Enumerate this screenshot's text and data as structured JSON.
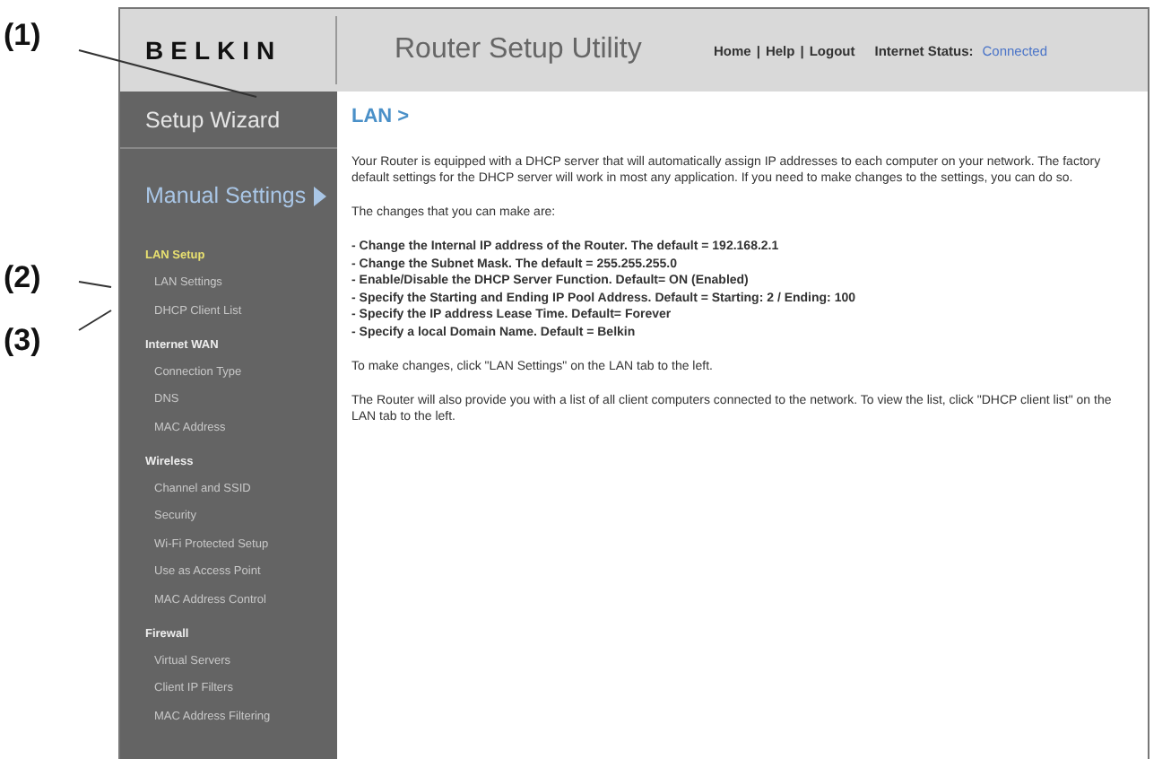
{
  "callouts": [
    {
      "label": "(1)"
    },
    {
      "label": "(2)"
    },
    {
      "label": "(3)"
    }
  ],
  "header": {
    "logo": "BELKIN",
    "title": "Router Setup Utility",
    "links": [
      "Home",
      "Help",
      "Logout"
    ],
    "link_separator": "|",
    "status_label": "Internet Status:",
    "status_value": "Connected"
  },
  "sidebar": {
    "wizard": "Setup Wizard",
    "manual": "Manual Settings",
    "sections": [
      {
        "title": "LAN Setup",
        "selected": true,
        "items": [
          "LAN Settings",
          "DHCP Client List"
        ]
      },
      {
        "title": "Internet WAN",
        "selected": false,
        "items": [
          "Connection Type",
          "DNS",
          "MAC Address"
        ]
      },
      {
        "title": "Wireless",
        "selected": false,
        "items": [
          "Channel and SSID",
          "Security",
          "Wi-Fi Protected Setup",
          "Use as Access Point",
          "MAC Address Control"
        ]
      },
      {
        "title": "Firewall",
        "selected": false,
        "items": [
          "Virtual Servers",
          "Client IP Filters",
          "MAC Address Filtering"
        ]
      }
    ]
  },
  "content": {
    "breadcrumb": "LAN >",
    "intro": "Your Router is equipped with a DHCP server that will automatically assign IP addresses to each computer on your network. The factory default settings for the DHCP server will work in most any application. If you need to make changes to the settings, you can do so.",
    "changes_heading": "The changes that you can make are:",
    "changes": [
      "- Change the Internal IP address of the Router. The default = 192.168.2.1",
      "- Change the Subnet Mask. The default = 255.255.255.0",
      "- Enable/Disable the DHCP Server Function. Default= ON (Enabled)",
      "- Specify the Starting and Ending IP Pool Address. Default = Starting: 2 / Ending: 100",
      "- Specify the IP address Lease Time. Default= Forever",
      "- Specify a local Domain Name. Default = Belkin"
    ],
    "note1": "To make changes, click \"LAN Settings\" on the LAN tab to the left.",
    "note2": "The Router will also provide you with a list of all client computers connected to the network. To view the list, click \"DHCP client list\" on the LAN tab to the left."
  }
}
